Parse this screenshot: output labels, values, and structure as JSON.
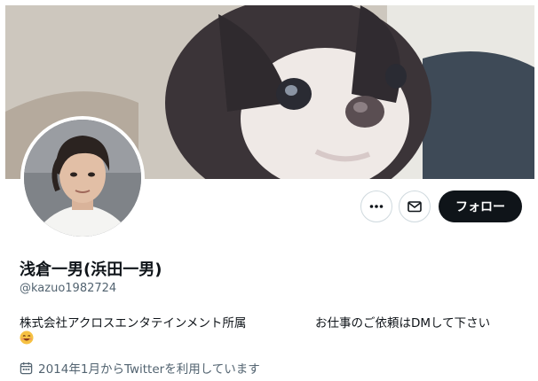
{
  "profile": {
    "display_name": "浅倉一男(浜田一男)",
    "handle": "@kazuo1982724",
    "bio_company": "株式会社アクロスエンタテインメント所属",
    "bio_contact": "お仕事のご依頼はDMして下さい",
    "joined": "2014年1月からTwitterを利用しています"
  },
  "actions": {
    "follow_label": "フォロー"
  },
  "icons": {
    "more": "more-icon",
    "message": "envelope-icon",
    "calendar": "calendar-icon",
    "emoji": "smiling-face-emoji"
  },
  "colors": {
    "follow_bg": "#0f1419",
    "secondary_text": "#536471",
    "button_border": "#cfd9de"
  }
}
